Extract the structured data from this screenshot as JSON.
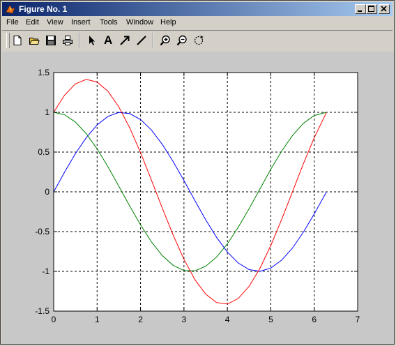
{
  "window": {
    "title": "Figure No. 1",
    "buttons": [
      "minimize",
      "maximize",
      "close"
    ]
  },
  "menubar": {
    "items": [
      "File",
      "Edit",
      "View",
      "Insert",
      "Tools",
      "Window",
      "Help"
    ]
  },
  "toolbar": {
    "tools": [
      "new-figure",
      "open-file",
      "save",
      "print",
      "edit-plot-arrow",
      "insert-text",
      "insert-arrow",
      "insert-line",
      "zoom-in",
      "zoom-out",
      "rotate-3d"
    ],
    "text_tool_label": "A"
  },
  "colors": {
    "title_gradient_start": "#0a246a",
    "title_gradient_end": "#a6caf0",
    "figure_background": "#c8c8c8",
    "axes_background": "#ffffff"
  },
  "chart_data": {
    "type": "line",
    "title": "",
    "xlabel": "",
    "ylabel": "",
    "xlim": [
      0,
      7
    ],
    "ylim": [
      -1.5,
      1.5
    ],
    "xticks": [
      0,
      1,
      2,
      3,
      4,
      5,
      6,
      7
    ],
    "yticks": [
      1.5,
      1,
      0.5,
      0,
      -0.5,
      -1,
      -1.5
    ],
    "xtick_labels": [
      "0",
      "1",
      "2",
      "3",
      "4",
      "5",
      "6",
      "7"
    ],
    "ytick_labels": [
      "1.5",
      "1",
      "0.5",
      "0",
      "-0.5",
      "-1",
      "-1.5"
    ],
    "grid": true,
    "grid_style": "dashed",
    "legend": false,
    "x": [
      0,
      0.25,
      0.5,
      0.75,
      1,
      1.25,
      1.5,
      1.75,
      2,
      2.25,
      2.5,
      2.75,
      3,
      3.25,
      3.5,
      3.75,
      4,
      4.25,
      4.5,
      4.75,
      5,
      5.25,
      5.5,
      5.75,
      6,
      6.28
    ],
    "series": [
      {
        "color": "#0000ff",
        "values": [
          0,
          0.247,
          0.479,
          0.682,
          0.841,
          0.949,
          0.997,
          0.984,
          0.909,
          0.778,
          0.598,
          0.382,
          0.141,
          -0.108,
          -0.351,
          -0.572,
          -0.757,
          -0.895,
          -0.978,
          -0.999,
          -0.959,
          -0.859,
          -0.706,
          -0.508,
          -0.279,
          -0.003
        ]
      },
      {
        "color": "#008000",
        "values": [
          1,
          0.969,
          0.878,
          0.732,
          0.54,
          0.315,
          0.071,
          -0.178,
          -0.416,
          -0.628,
          -0.801,
          -0.924,
          -0.99,
          -0.994,
          -0.936,
          -0.82,
          -0.654,
          -0.446,
          -0.211,
          0.038,
          0.284,
          0.512,
          0.709,
          0.861,
          0.96,
          1
        ]
      },
      {
        "color": "#ff0000",
        "values": [
          1,
          1.216,
          1.357,
          1.414,
          1.381,
          1.264,
          1.068,
          0.806,
          0.493,
          0.15,
          -0.203,
          -0.542,
          -0.849,
          -1.102,
          -1.287,
          -1.392,
          -1.411,
          -1.341,
          -1.189,
          -0.961,
          -0.675,
          -0.347,
          0.003,
          0.353,
          0.681,
          0.997
        ]
      }
    ]
  }
}
